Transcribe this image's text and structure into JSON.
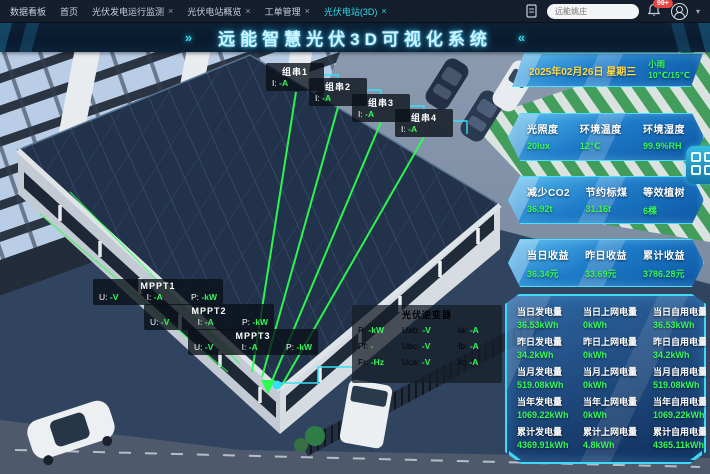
{
  "topbar": {
    "tabs": [
      {
        "label": "数据看板",
        "closable": false,
        "active": false
      },
      {
        "label": "首页",
        "closable": false,
        "active": false
      },
      {
        "label": "光伏发电运行监测",
        "closable": true,
        "active": false
      },
      {
        "label": "光伏电站概览",
        "closable": true,
        "active": false
      },
      {
        "label": "工单管理",
        "closable": true,
        "active": false
      },
      {
        "label": "光伏电站(3D)",
        "closable": true,
        "active": true
      }
    ],
    "close_glyph": "×",
    "search_text": "远能姚庄",
    "notification_badge": "99+"
  },
  "header": {
    "title": "远能智慧光伏3D可视化系统",
    "left_decor": "»",
    "right_decor": "«"
  },
  "scene": {
    "strings": [
      {
        "name": "组串1",
        "k": "I:",
        "v": "-A"
      },
      {
        "name": "组串2",
        "k": "I:",
        "v": "-A"
      },
      {
        "name": "组串3",
        "k": "I:",
        "v": "-A"
      },
      {
        "name": "组串4",
        "k": "I:",
        "v": "-A"
      }
    ],
    "mppts": [
      {
        "name": "MPPT1",
        "pairs": [
          {
            "k": "U:",
            "v": "-V"
          },
          {
            "k": "I:",
            "v": "-A"
          },
          {
            "k": "P:",
            "v": "-kW"
          }
        ]
      },
      {
        "name": "MPPT2",
        "pairs": [
          {
            "k": "U:",
            "v": "-V"
          },
          {
            "k": "I:",
            "v": "-A"
          },
          {
            "k": "P:",
            "v": "-kW"
          }
        ]
      },
      {
        "name": "MPPT3",
        "pairs": [
          {
            "k": "U:",
            "v": "-V"
          },
          {
            "k": "I:",
            "v": "-A"
          },
          {
            "k": "P:",
            "v": "-kW"
          }
        ]
      }
    ],
    "inverter": {
      "title": "光伏逆变器",
      "rows": [
        [
          {
            "k": "P:",
            "v": "-kW"
          },
          {
            "k": "Uab:",
            "v": "-V"
          },
          {
            "k": "Ia:",
            "v": "-A"
          }
        ],
        [
          {
            "k": "Pf:",
            "v": "-"
          },
          {
            "k": "Ubc:",
            "v": "-V"
          },
          {
            "k": "Ib:",
            "v": "-A"
          }
        ],
        [
          {
            "k": "Fr:",
            "v": "-Hz"
          },
          {
            "k": "Uca:",
            "v": "-V"
          },
          {
            "k": "Ic:",
            "v": "-A"
          }
        ]
      ]
    }
  },
  "sidebar": {
    "date": "2025年02月26日 星期三",
    "weather_desc": "小雨",
    "weather_temp": "10℃/15℃",
    "env": {
      "items": [
        {
          "label": "光照度",
          "value": "20lux"
        },
        {
          "label": "环境温度",
          "value": "12℃"
        },
        {
          "label": "环境湿度",
          "value": "99.9%RH"
        }
      ]
    },
    "benefit": {
      "items": [
        {
          "label": "减少CO2",
          "value": "36.92t"
        },
        {
          "label": "节约标煤",
          "value": "31.16t"
        },
        {
          "label": "等效植树",
          "value": "6棵"
        }
      ]
    },
    "income": {
      "items": [
        {
          "label": "当日收益",
          "value": "36.34元"
        },
        {
          "label": "昨日收益",
          "value": "33.69元"
        },
        {
          "label": "累计收益",
          "value": "3786.28元"
        }
      ]
    },
    "energy": {
      "cells": [
        {
          "label": "当日发电量",
          "value": "36.53kWh"
        },
        {
          "label": "当日上网电量",
          "value": "0kWh"
        },
        {
          "label": "当日自用电量",
          "value": "36.53kWh"
        },
        {
          "label": "昨日发电量",
          "value": "34.2kWh"
        },
        {
          "label": "昨日上网电量",
          "value": "0kWh"
        },
        {
          "label": "昨日自用电量",
          "value": "34.2kWh"
        },
        {
          "label": "当月发电量",
          "value": "519.08kWh"
        },
        {
          "label": "当月上网电量",
          "value": "0kWh"
        },
        {
          "label": "当月自用电量",
          "value": "519.08kWh"
        },
        {
          "label": "当年发电量",
          "value": "1069.22kWh"
        },
        {
          "label": "当年上网电量",
          "value": "0kWh"
        },
        {
          "label": "当年自用电量",
          "value": "1069.22kWh"
        },
        {
          "label": "累计发电量",
          "value": "4369.91kWh"
        },
        {
          "label": "累计上网电量",
          "value": "4.8kWh"
        },
        {
          "label": "累计自用电量",
          "value": "4365.11kWh"
        }
      ]
    }
  },
  "colors": {
    "accent_cyan": "#35dcf5",
    "value_green": "#39f65a",
    "date_yellow": "#ffd94a",
    "badge_red": "#e84545",
    "active_tab": "#2fd9ea"
  }
}
